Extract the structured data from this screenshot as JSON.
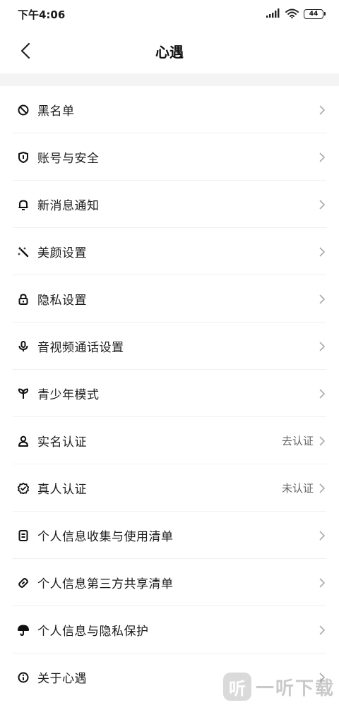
{
  "status_bar": {
    "time": "下午4:06",
    "battery": "44",
    "icons": [
      "signal-icon",
      "wifi-icon",
      "battery-icon"
    ]
  },
  "header": {
    "title": "心遇",
    "back_icon": "back-arrow-icon"
  },
  "menu": {
    "items": [
      {
        "label": "黑名单",
        "status": "",
        "icon": "block-icon"
      },
      {
        "label": "账号与安全",
        "status": "",
        "icon": "shield-icon"
      },
      {
        "label": "新消息通知",
        "status": "",
        "icon": "bell-icon"
      },
      {
        "label": "美颜设置",
        "status": "",
        "icon": "magic-wand-icon"
      },
      {
        "label": "隐私设置",
        "status": "",
        "icon": "lock-icon"
      },
      {
        "label": "音视频通话设置",
        "status": "",
        "icon": "microphone-icon"
      },
      {
        "label": "青少年模式",
        "status": "",
        "icon": "sprout-icon"
      },
      {
        "label": "实名认证",
        "status": "去认证",
        "icon": "person-icon"
      },
      {
        "label": "真人认证",
        "status": "未认证",
        "icon": "verified-badge-icon"
      },
      {
        "label": "个人信息收集与使用清单",
        "status": "",
        "icon": "document-icon"
      },
      {
        "label": "个人信息第三方共享清单",
        "status": "",
        "icon": "link-icon"
      },
      {
        "label": "个人信息与隐私保护",
        "status": "",
        "icon": "umbrella-icon"
      },
      {
        "label": "关于心遇",
        "status": "",
        "icon": "info-icon"
      }
    ]
  },
  "watermark": {
    "logo": "听",
    "text": "一听下载"
  }
}
